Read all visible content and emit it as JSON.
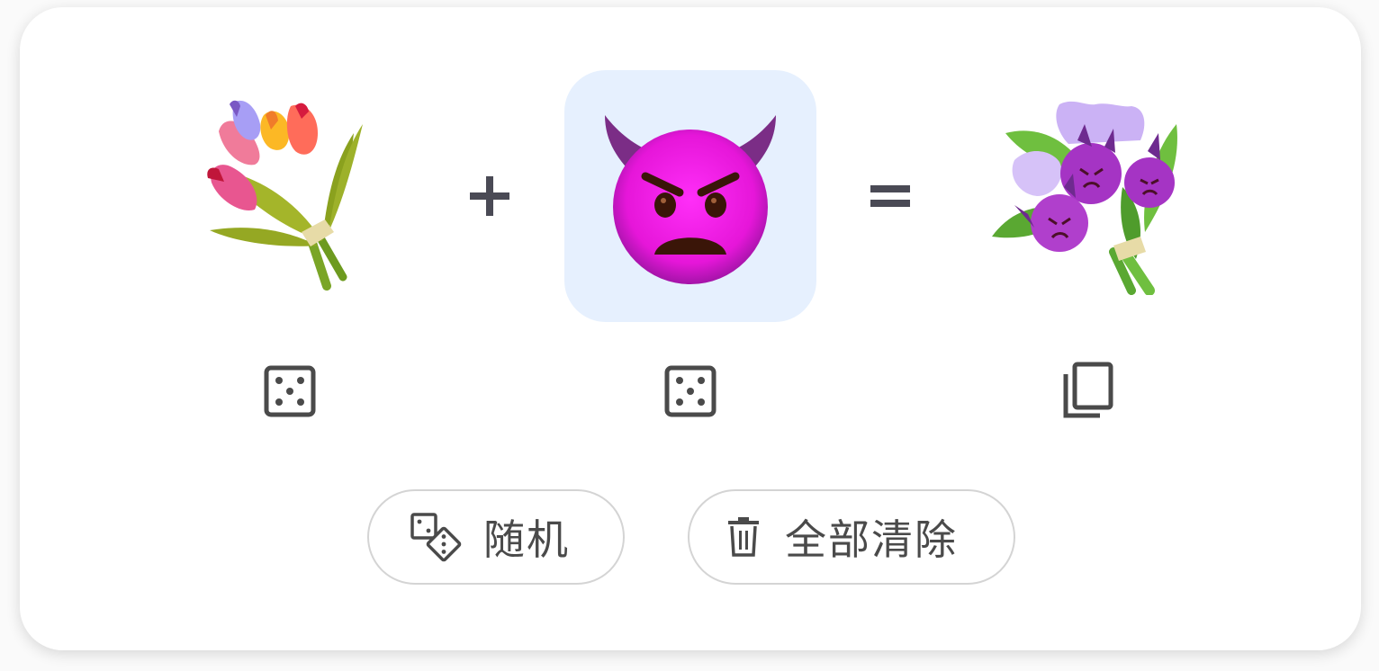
{
  "mixer": {
    "left_emoji": "bouquet",
    "right_emoji": "smiling-face-with-horns-angry",
    "result_emoji": "purple-devil-bouquet",
    "plus_symbol": "+",
    "equals_symbol": "=",
    "selected_slot": "right",
    "selected_color": "#e6f0fe"
  },
  "actions": {
    "random_label": "随机",
    "clear_label": "全部清除"
  },
  "icons": {
    "left_dice": "dice-icon",
    "right_dice": "dice-icon",
    "copy": "copy-icon",
    "random": "dice-pair-icon",
    "clear": "trash-icon"
  },
  "colors": {
    "icon": "#4a4a4a",
    "border": "#d4d4d4"
  }
}
